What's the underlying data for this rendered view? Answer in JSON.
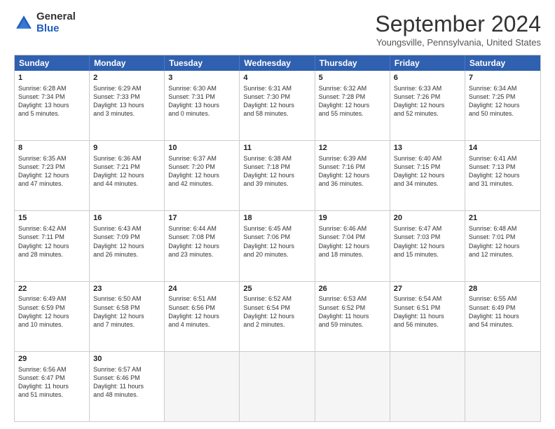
{
  "header": {
    "logo_general": "General",
    "logo_blue": "Blue",
    "month_title": "September 2024",
    "location": "Youngsville, Pennsylvania, United States"
  },
  "days_of_week": [
    "Sunday",
    "Monday",
    "Tuesday",
    "Wednesday",
    "Thursday",
    "Friday",
    "Saturday"
  ],
  "weeks": [
    [
      {
        "day": "1",
        "lines": [
          "Sunrise: 6:28 AM",
          "Sunset: 7:34 PM",
          "Daylight: 13 hours",
          "and 5 minutes."
        ]
      },
      {
        "day": "2",
        "lines": [
          "Sunrise: 6:29 AM",
          "Sunset: 7:33 PM",
          "Daylight: 13 hours",
          "and 3 minutes."
        ]
      },
      {
        "day": "3",
        "lines": [
          "Sunrise: 6:30 AM",
          "Sunset: 7:31 PM",
          "Daylight: 13 hours",
          "and 0 minutes."
        ]
      },
      {
        "day": "4",
        "lines": [
          "Sunrise: 6:31 AM",
          "Sunset: 7:30 PM",
          "Daylight: 12 hours",
          "and 58 minutes."
        ]
      },
      {
        "day": "5",
        "lines": [
          "Sunrise: 6:32 AM",
          "Sunset: 7:28 PM",
          "Daylight: 12 hours",
          "and 55 minutes."
        ]
      },
      {
        "day": "6",
        "lines": [
          "Sunrise: 6:33 AM",
          "Sunset: 7:26 PM",
          "Daylight: 12 hours",
          "and 52 minutes."
        ]
      },
      {
        "day": "7",
        "lines": [
          "Sunrise: 6:34 AM",
          "Sunset: 7:25 PM",
          "Daylight: 12 hours",
          "and 50 minutes."
        ]
      }
    ],
    [
      {
        "day": "8",
        "lines": [
          "Sunrise: 6:35 AM",
          "Sunset: 7:23 PM",
          "Daylight: 12 hours",
          "and 47 minutes."
        ]
      },
      {
        "day": "9",
        "lines": [
          "Sunrise: 6:36 AM",
          "Sunset: 7:21 PM",
          "Daylight: 12 hours",
          "and 44 minutes."
        ]
      },
      {
        "day": "10",
        "lines": [
          "Sunrise: 6:37 AM",
          "Sunset: 7:20 PM",
          "Daylight: 12 hours",
          "and 42 minutes."
        ]
      },
      {
        "day": "11",
        "lines": [
          "Sunrise: 6:38 AM",
          "Sunset: 7:18 PM",
          "Daylight: 12 hours",
          "and 39 minutes."
        ]
      },
      {
        "day": "12",
        "lines": [
          "Sunrise: 6:39 AM",
          "Sunset: 7:16 PM",
          "Daylight: 12 hours",
          "and 36 minutes."
        ]
      },
      {
        "day": "13",
        "lines": [
          "Sunrise: 6:40 AM",
          "Sunset: 7:15 PM",
          "Daylight: 12 hours",
          "and 34 minutes."
        ]
      },
      {
        "day": "14",
        "lines": [
          "Sunrise: 6:41 AM",
          "Sunset: 7:13 PM",
          "Daylight: 12 hours",
          "and 31 minutes."
        ]
      }
    ],
    [
      {
        "day": "15",
        "lines": [
          "Sunrise: 6:42 AM",
          "Sunset: 7:11 PM",
          "Daylight: 12 hours",
          "and 28 minutes."
        ]
      },
      {
        "day": "16",
        "lines": [
          "Sunrise: 6:43 AM",
          "Sunset: 7:09 PM",
          "Daylight: 12 hours",
          "and 26 minutes."
        ]
      },
      {
        "day": "17",
        "lines": [
          "Sunrise: 6:44 AM",
          "Sunset: 7:08 PM",
          "Daylight: 12 hours",
          "and 23 minutes."
        ]
      },
      {
        "day": "18",
        "lines": [
          "Sunrise: 6:45 AM",
          "Sunset: 7:06 PM",
          "Daylight: 12 hours",
          "and 20 minutes."
        ]
      },
      {
        "day": "19",
        "lines": [
          "Sunrise: 6:46 AM",
          "Sunset: 7:04 PM",
          "Daylight: 12 hours",
          "and 18 minutes."
        ]
      },
      {
        "day": "20",
        "lines": [
          "Sunrise: 6:47 AM",
          "Sunset: 7:03 PM",
          "Daylight: 12 hours",
          "and 15 minutes."
        ]
      },
      {
        "day": "21",
        "lines": [
          "Sunrise: 6:48 AM",
          "Sunset: 7:01 PM",
          "Daylight: 12 hours",
          "and 12 minutes."
        ]
      }
    ],
    [
      {
        "day": "22",
        "lines": [
          "Sunrise: 6:49 AM",
          "Sunset: 6:59 PM",
          "Daylight: 12 hours",
          "and 10 minutes."
        ]
      },
      {
        "day": "23",
        "lines": [
          "Sunrise: 6:50 AM",
          "Sunset: 6:58 PM",
          "Daylight: 12 hours",
          "and 7 minutes."
        ]
      },
      {
        "day": "24",
        "lines": [
          "Sunrise: 6:51 AM",
          "Sunset: 6:56 PM",
          "Daylight: 12 hours",
          "and 4 minutes."
        ]
      },
      {
        "day": "25",
        "lines": [
          "Sunrise: 6:52 AM",
          "Sunset: 6:54 PM",
          "Daylight: 12 hours",
          "and 2 minutes."
        ]
      },
      {
        "day": "26",
        "lines": [
          "Sunrise: 6:53 AM",
          "Sunset: 6:52 PM",
          "Daylight: 11 hours",
          "and 59 minutes."
        ]
      },
      {
        "day": "27",
        "lines": [
          "Sunrise: 6:54 AM",
          "Sunset: 6:51 PM",
          "Daylight: 11 hours",
          "and 56 minutes."
        ]
      },
      {
        "day": "28",
        "lines": [
          "Sunrise: 6:55 AM",
          "Sunset: 6:49 PM",
          "Daylight: 11 hours",
          "and 54 minutes."
        ]
      }
    ],
    [
      {
        "day": "29",
        "lines": [
          "Sunrise: 6:56 AM",
          "Sunset: 6:47 PM",
          "Daylight: 11 hours",
          "and 51 minutes."
        ]
      },
      {
        "day": "30",
        "lines": [
          "Sunrise: 6:57 AM",
          "Sunset: 6:46 PM",
          "Daylight: 11 hours",
          "and 48 minutes."
        ]
      },
      {
        "day": "",
        "lines": [],
        "empty": true
      },
      {
        "day": "",
        "lines": [],
        "empty": true
      },
      {
        "day": "",
        "lines": [],
        "empty": true
      },
      {
        "day": "",
        "lines": [],
        "empty": true
      },
      {
        "day": "",
        "lines": [],
        "empty": true
      }
    ]
  ]
}
